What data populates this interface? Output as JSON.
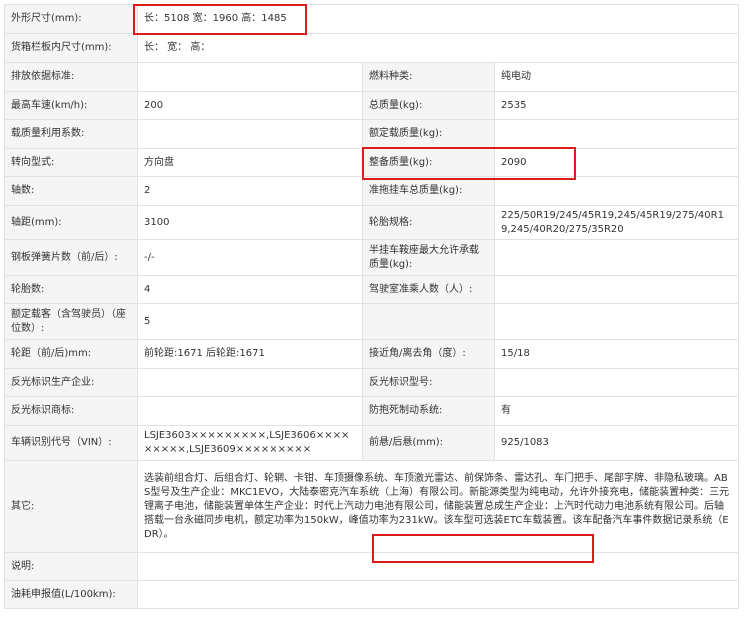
{
  "rows": [
    {
      "cells": [
        {
          "k": "外形尺寸(mm):",
          "v": "长：5108 宽：1960 高：1485",
          "span": true
        }
      ]
    },
    {
      "cells": [
        {
          "k": "货箱栏板内尺寸(mm):",
          "v": "长： 宽： 高：",
          "span": true
        }
      ]
    },
    {
      "cells": [
        {
          "k": "排放依据标准:",
          "v": ""
        },
        {
          "k": "燃料种类:",
          "v": "纯电动"
        }
      ]
    },
    {
      "cells": [
        {
          "k": "最高车速(km/h):",
          "v": "200"
        },
        {
          "k": "总质量(kg):",
          "v": "2535"
        }
      ]
    },
    {
      "cells": [
        {
          "k": "载质量利用系数:",
          "v": ""
        },
        {
          "k": "额定载质量(kg):",
          "v": ""
        }
      ]
    },
    {
      "cells": [
        {
          "k": "转向型式:",
          "v": "方向盘"
        },
        {
          "k": "整备质量(kg):",
          "v": "2090"
        }
      ]
    },
    {
      "cells": [
        {
          "k": "轴数:",
          "v": "2"
        },
        {
          "k": "准拖挂车总质量(kg):",
          "v": ""
        }
      ]
    },
    {
      "cells": [
        {
          "k": "轴距(mm):",
          "v": "3100"
        },
        {
          "k": "轮胎规格:",
          "v": "225/50R19/245/45R19,245/45R19/275/40R19,245/40R20/275/35R20"
        }
      ]
    },
    {
      "cells": [
        {
          "k": "钢板弹簧片数（前/后）:",
          "v": "-/-"
        },
        {
          "k": "半挂车鞍座最大允许承载质量(kg):",
          "v": ""
        }
      ]
    },
    {
      "cells": [
        {
          "k": "轮胎数:",
          "v": "4"
        },
        {
          "k": "驾驶室准乘人数（人）:",
          "v": ""
        }
      ]
    },
    {
      "cells": [
        {
          "k": "额定载客（含驾驶员）（座位数）:",
          "v": "5"
        },
        {
          "k": "",
          "v": ""
        }
      ]
    },
    {
      "cells": [
        {
          "k": "轮距（前/后)mm:",
          "v": "前轮距:1671 后轮距:1671"
        },
        {
          "k": "接近角/离去角（度）:",
          "v": "15/18"
        }
      ]
    },
    {
      "cells": [
        {
          "k": "反光标识生产企业:",
          "v": ""
        },
        {
          "k": "反光标识型号:",
          "v": ""
        }
      ]
    },
    {
      "cells": [
        {
          "k": "反光标识商标:",
          "v": ""
        },
        {
          "k": "防抱死制动系统:",
          "v": "有"
        }
      ]
    },
    {
      "cells": [
        {
          "k": "车辆识别代号（VIN）:",
          "v": "LSJE3603×××××××××,LSJE3606×××××××××,LSJE3609×××××××××"
        },
        {
          "k": "前悬/后悬(mm):",
          "v": "925/1083"
        }
      ]
    },
    {
      "cells": [
        {
          "k": "其它:",
          "v": "选装前组合灯、后组合灯、轮辋、卡钳、车顶摄像系统、车顶激光雷达、前保饰条、雷达孔、车门把手、尾部字牌、非隐私玻璃。ABS型号及生产企业：MKC1EVO，大陆泰密克汽车系统（上海）有限公司。新能源类型为纯电动，允许外接充电，储能装置种类：三元锂离子电池，储能装置单体生产企业：时代上汽动力电池有限公司，储能装置总成生产企业：上汽时代动力电池系统有限公司。后轴搭载一台永磁同步电机，额定功率为150kW，峰值功率为231kW。该车型可选装ETC车载装置。该车配备汽车事件数据记录系统（EDR）。",
          "span": true
        }
      ]
    },
    {
      "cells": [
        {
          "k": "说明:",
          "v": "",
          "span": true
        }
      ]
    },
    {
      "cells": [
        {
          "k": "油耗申报值(L/100km):",
          "v": "",
          "span": true
        }
      ]
    }
  ]
}
